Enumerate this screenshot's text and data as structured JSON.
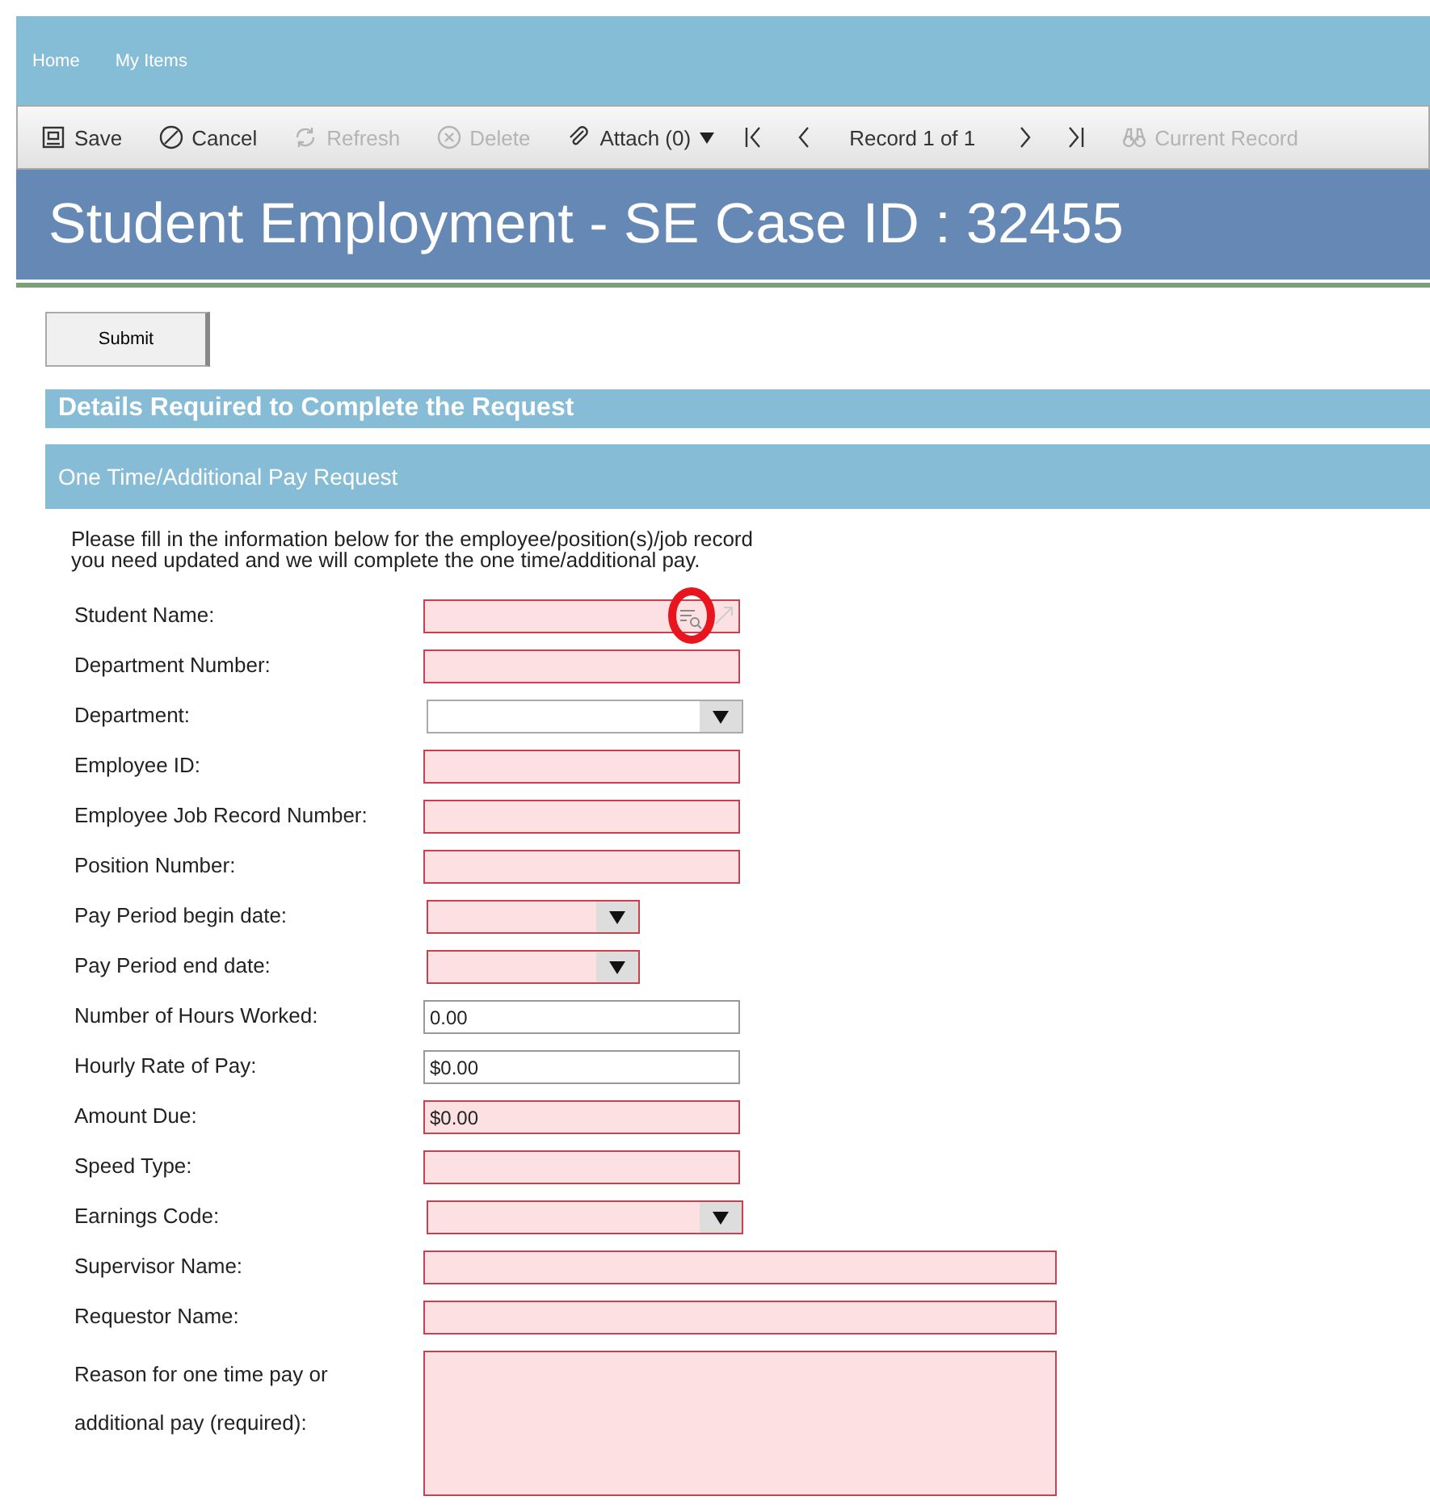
{
  "nav": {
    "items": [
      {
        "label": "Home"
      },
      {
        "label": "My Items"
      }
    ]
  },
  "toolbar": {
    "items": [
      {
        "kind": "save",
        "label": "Save",
        "disabled": false
      },
      {
        "kind": "cancel",
        "label": "Cancel",
        "disabled": false
      },
      {
        "kind": "refresh",
        "label": "Refresh",
        "disabled": true
      },
      {
        "kind": "delete",
        "label": "Delete",
        "disabled": true
      },
      {
        "kind": "attach",
        "label": "Attach (0)",
        "disabled": false
      },
      {
        "kind": "first",
        "disabled": false
      },
      {
        "kind": "prev",
        "disabled": false
      },
      {
        "kind": "record",
        "label": "Record 1 of 1",
        "disabled": false
      },
      {
        "kind": "next",
        "disabled": false
      },
      {
        "kind": "last",
        "disabled": false
      },
      {
        "kind": "current",
        "label": "Current Record",
        "disabled": true
      }
    ]
  },
  "title": "Student Employment - SE Case ID : 32455",
  "submit_button": "Submit",
  "sections": [
    {
      "kind": "major",
      "title": "Details Required to Complete the Request"
    },
    {
      "kind": "minor",
      "title": "One Time/Additional Pay Request"
    }
  ],
  "intro": [
    "Please fill in the information below for the employee/position(s)/job record",
    "you need updated and we will complete the one time/additional pay."
  ],
  "fields": [
    {
      "label": "Student Name:",
      "kind": "lookup",
      "required": true,
      "annotated": true
    },
    {
      "label": "Department Number:",
      "kind": "text",
      "required": true
    },
    {
      "label": "Department:",
      "kind": "select",
      "required": false
    },
    {
      "label": "Employee ID:",
      "kind": "text",
      "required": true
    },
    {
      "label": "Employee Job Record Number:",
      "kind": "text",
      "required": true
    },
    {
      "label": "Position Number:",
      "kind": "text",
      "required": true
    },
    {
      "label": "Pay Period begin date:",
      "kind": "short-select",
      "required": true
    },
    {
      "label": "Pay Period end date:",
      "kind": "short-select",
      "required": true
    },
    {
      "label": "Number of Hours Worked:",
      "kind": "text",
      "required": false,
      "value": "0.00"
    },
    {
      "label": "Hourly Rate of Pay:",
      "kind": "text",
      "required": false,
      "value": "$0.00"
    },
    {
      "label": "Amount Due:",
      "kind": "text",
      "required": true,
      "value": "$0.00"
    },
    {
      "label": "Speed Type:",
      "kind": "text",
      "required": true
    },
    {
      "label": "Earnings Code:",
      "kind": "select",
      "required": true
    },
    {
      "label": "Supervisor Name:",
      "kind": "wide-text",
      "required": true
    },
    {
      "label": "Requestor Name:",
      "kind": "wide-text",
      "required": true
    },
    {
      "label": "Reason for one time pay or additional pay (required):",
      "kind": "textarea",
      "required": true
    }
  ]
}
